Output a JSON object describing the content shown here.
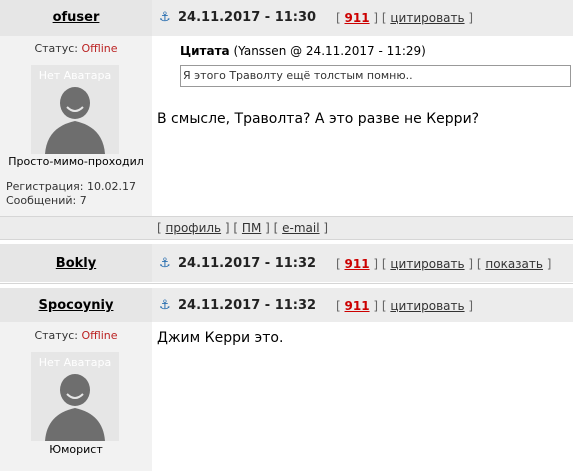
{
  "posts": [
    {
      "author": "ofuser",
      "date": "24.11.2017 - 11:30",
      "number": "911",
      "actions": [
        "цитировать"
      ],
      "status_label": "Статус: ",
      "status_value": "Offline",
      "avatar_text": "Нет Аватара",
      "rank": "Просто-мимо-проходил",
      "registration": "Регистрация: 10.02.17",
      "messages": "Сообщений: 7",
      "quote_label": "Цитата",
      "quote_meta": "(Yanssen @ 24.11.2017 - 11:29)",
      "quote_text": "Я этого Траволту ещё толстым помню..",
      "text": "В смысле, Траволта? А это разве не Керри?",
      "footer": [
        "профиль",
        "ПМ",
        "e-mail"
      ]
    },
    {
      "author": "Bokly",
      "date": "24.11.2017 - 11:32",
      "number": "911",
      "actions": [
        "цитировать",
        "показать"
      ]
    },
    {
      "author": "Spocoyniy",
      "date": "24.11.2017 - 11:32",
      "number": "911",
      "actions": [
        "цитировать"
      ],
      "status_label": "Статус: ",
      "status_value": "Offline",
      "avatar_text": "Нет Аватара",
      "rank": "Юморист",
      "text": "Джим Керри это."
    }
  ],
  "icons": {
    "post_icon": "anchor-icon"
  },
  "colors": {
    "post_number": "#cc0000",
    "offline": "#b22222",
    "header_bg": "#ececec"
  }
}
